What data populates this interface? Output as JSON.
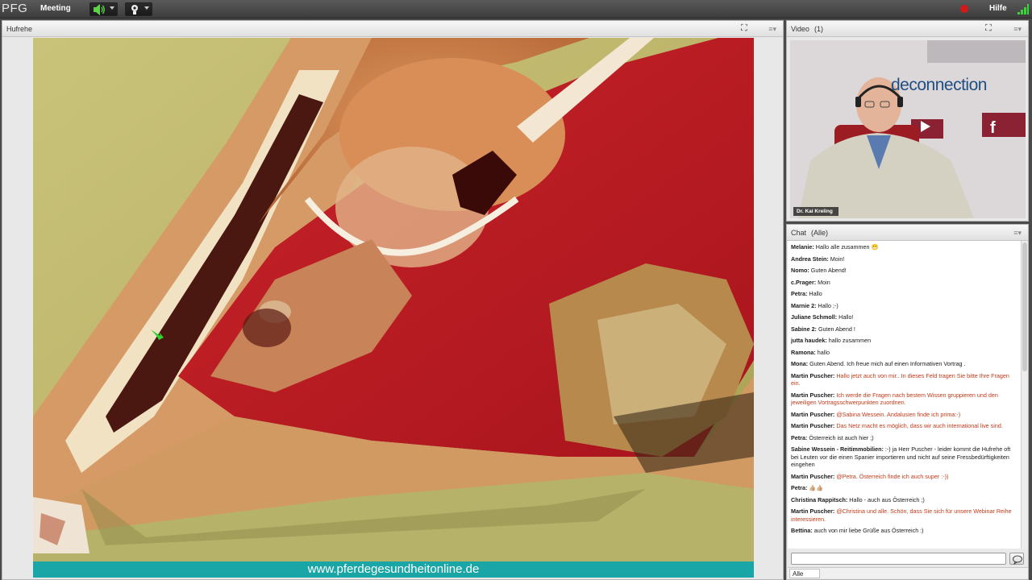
{
  "topbar": {
    "logo": "PFG",
    "meeting_label": "Meeting",
    "help_label": "Hilfe",
    "speaker_icon": "speaker-icon",
    "camera_icon": "webcam-icon"
  },
  "share_pod": {
    "title": "Hufrehe",
    "footer_url": "www.pferdegesundheitonline.de"
  },
  "video_pod": {
    "title": "Video",
    "count": "(1)",
    "presenter_name": "Dr. Kai Kreling",
    "backdrop_text": "deconnection"
  },
  "chat_pod": {
    "title": "Chat",
    "scope": "(Alle)",
    "bottom_tab": "Alle",
    "messages": [
      {
        "author": "Melanie:",
        "text": " Hallo alle zusammen 😁",
        "highlight": false
      },
      {
        "author": "Andrea Stein:",
        "text": " Moin!",
        "highlight": false
      },
      {
        "author": "Nomo:",
        "text": " Guten Abend!",
        "highlight": false
      },
      {
        "author": "c.Prager:",
        "text": " Moin",
        "highlight": false
      },
      {
        "author": "Petra:",
        "text": " Hallo",
        "highlight": false
      },
      {
        "author": "Marnie 2:",
        "text": " Hallo ;-)",
        "highlight": false
      },
      {
        "author": "Juliane Schmoll:",
        "text": " Hallo!",
        "highlight": false
      },
      {
        "author": "Sabine 2:",
        "text": " Guten Abend !",
        "highlight": false
      },
      {
        "author": "jutta haudek:",
        "text": " hallo zusammen",
        "highlight": false
      },
      {
        "author": "Ramona:",
        "text": " hallo",
        "highlight": false
      },
      {
        "author": "Mona:",
        "text": " Guten Abend. Ich freue mich auf einen Informativen Vortrag .",
        "highlight": false
      },
      {
        "author": "Martin Puscher:",
        "text": " Hallo jetzt auch von mir.. In dieses Feld tragen Sie bitte Ihre Fragen ein.",
        "highlight": true
      },
      {
        "author": "Martin Puscher:",
        "text": " Ich werde die Fragen nach bestem Wissen gruppieren und den jeweiligen Vortragsschwerpunkten zuordnen.",
        "highlight": true
      },
      {
        "author": "Martin Puscher:",
        "text": " @Sabina Wessein. Andalusien finde ich prima:-)",
        "highlight": true
      },
      {
        "author": "Martin Puscher:",
        "text": " Das Netz macht es möglich, dass wir auch international live sind.",
        "highlight": true
      },
      {
        "author": "Petra:",
        "text": " Österreich ist auch hier ;)",
        "highlight": false
      },
      {
        "author": "Sabine Wessein - Reitimmobilien:",
        "text": " :-) ja Herr Puscher - leider kommt die Hufrehe oft bei Leuten vor die einen Spanier importieren und nicht auf seine Fressbedürftigkeiten eingehen",
        "highlight": false
      },
      {
        "author": "Martin Puscher:",
        "text": " @Petra. Österreich finde ich auch super :-))",
        "highlight": true
      },
      {
        "author": "Petra:",
        "text": " 👍🏼👍🏼",
        "highlight": false
      },
      {
        "author": "Christina Rappitsch:",
        "text": " Hallo - auch aus Österreich ;)",
        "highlight": false
      },
      {
        "author": "Martin Puscher:",
        "text": " @Christina und alle. Schön, dass Sie sich für unsere Webinar Reihe interessieren.",
        "highlight": true
      },
      {
        "author": "Bettina:",
        "text": " auch von mir liebe Grüße aus Österreich :)",
        "highlight": false
      }
    ]
  },
  "colors": {
    "highlight_text": "#c43a1a",
    "footer_band": "#1aa6a6",
    "record": "#d21a1a"
  }
}
